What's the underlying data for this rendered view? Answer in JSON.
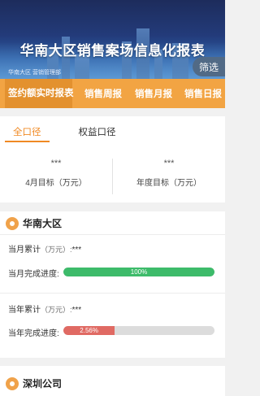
{
  "banner": {
    "title": "华南大区销售案场信息化报表",
    "subtitle": "华南大区 营销管理部",
    "filter_label": "筛选"
  },
  "tabs": [
    {
      "label": "签约额实时报表",
      "active": true
    },
    {
      "label": "销售周报",
      "active": false
    },
    {
      "label": "销售月报",
      "active": false
    },
    {
      "label": "销售日报",
      "active": false
    }
  ],
  "subtabs": [
    {
      "label": "全口径",
      "active": true
    },
    {
      "label": "权益口径",
      "active": false
    }
  ],
  "targets": {
    "month": {
      "value": "***",
      "label": "4月目标（万元）"
    },
    "year": {
      "value": "***",
      "label": "年度目标（万元）"
    }
  },
  "regions": [
    {
      "name": "华南大区",
      "month_cum_label": "当月累计",
      "month_cum_unit": "（万元）:",
      "month_cum_value": "***",
      "month_progress_label": "当月完成进度:",
      "month_progress": 100,
      "month_progress_text": "100%",
      "year_cum_label": "当年累计",
      "year_cum_unit": "（万元）:",
      "year_cum_value": "***",
      "year_progress_label": "当年完成进度:",
      "year_progress": 2.56,
      "year_progress_text": "2.56%"
    },
    {
      "name": "深圳公司"
    }
  ],
  "colors": {
    "accent": "#f2a443",
    "accent_dark": "#e3912f",
    "progress_good": "#3dbb6a",
    "progress_bad": "#e06a63"
  }
}
